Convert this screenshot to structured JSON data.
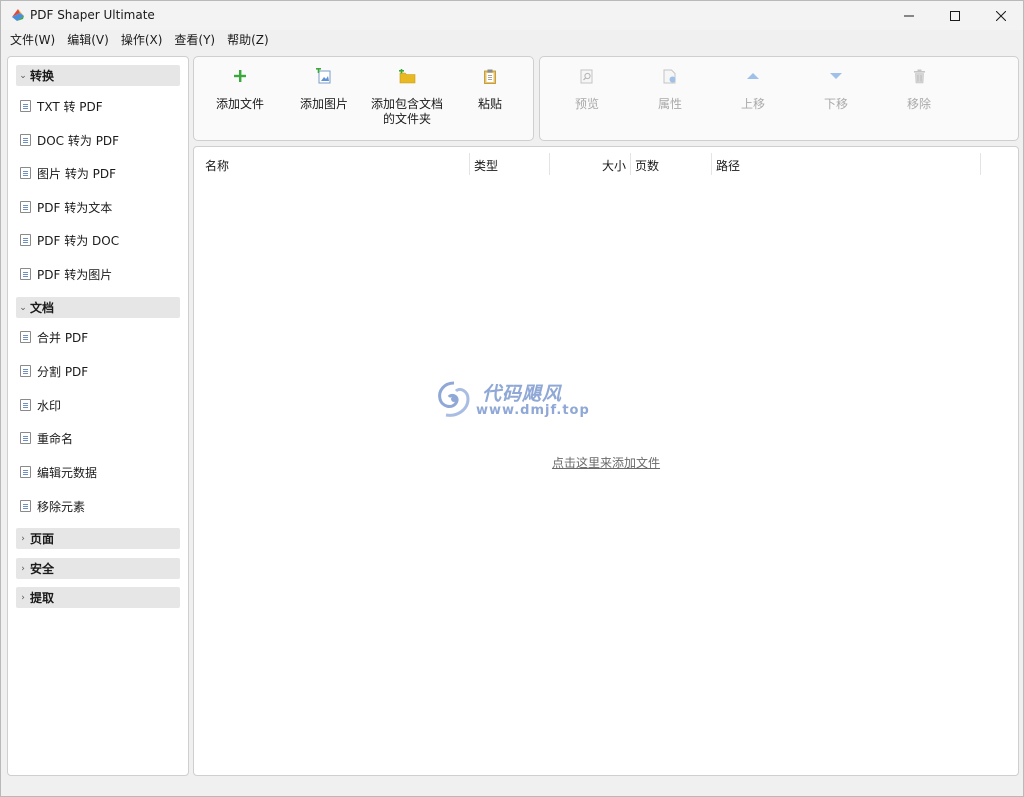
{
  "window": {
    "title": "PDF Shaper Ultimate"
  },
  "menu": [
    "文件(W)",
    "编辑(V)",
    "操作(X)",
    "查看(Y)",
    "帮助(Z)"
  ],
  "sidebar": {
    "sections": [
      {
        "title": "转换",
        "expanded": true,
        "items": [
          "TXT 转 PDF",
          "DOC 转为 PDF",
          "图片 转为 PDF",
          "PDF 转为文本",
          "PDF 转为 DOC",
          "PDF 转为图片"
        ]
      },
      {
        "title": "文档",
        "expanded": true,
        "items": [
          "合并 PDF",
          "分割 PDF",
          "水印",
          "重命名",
          "编辑元数据",
          "移除元素"
        ]
      },
      {
        "title": "页面",
        "expanded": false,
        "items": []
      },
      {
        "title": "安全",
        "expanded": false,
        "items": []
      },
      {
        "title": "提取",
        "expanded": false,
        "items": []
      }
    ]
  },
  "toolbar_left": [
    {
      "label": "添加文件",
      "icon": "plus-icon",
      "enabled": true
    },
    {
      "label": "添加图片",
      "icon": "add-image-icon",
      "enabled": true
    },
    {
      "label": "添加包含文档\n的文件夹",
      "icon": "add-folder-icon",
      "enabled": true
    },
    {
      "label": "粘贴",
      "icon": "paste-icon",
      "enabled": true
    }
  ],
  "toolbar_right": [
    {
      "label": "预览",
      "icon": "preview-icon",
      "enabled": false
    },
    {
      "label": "属性",
      "icon": "properties-icon",
      "enabled": false
    },
    {
      "label": "上移",
      "icon": "arrow-up-icon",
      "enabled": false
    },
    {
      "label": "下移",
      "icon": "arrow-down-icon",
      "enabled": false
    },
    {
      "label": "移除",
      "icon": "trash-icon",
      "enabled": false
    }
  ],
  "filelist": {
    "columns": [
      "名称",
      "类型",
      "大小",
      "页数",
      "路径"
    ],
    "empty_link": "点击这里来添加文件",
    "watermark_cn": "代码飓风",
    "watermark_en": "www.dmjf.top"
  },
  "colors": {
    "accent_green": "#3aa93a",
    "folder_yellow": "#e8b923",
    "disabled_blue": "#9fc0e8",
    "watermark": "#8fa8d6"
  }
}
